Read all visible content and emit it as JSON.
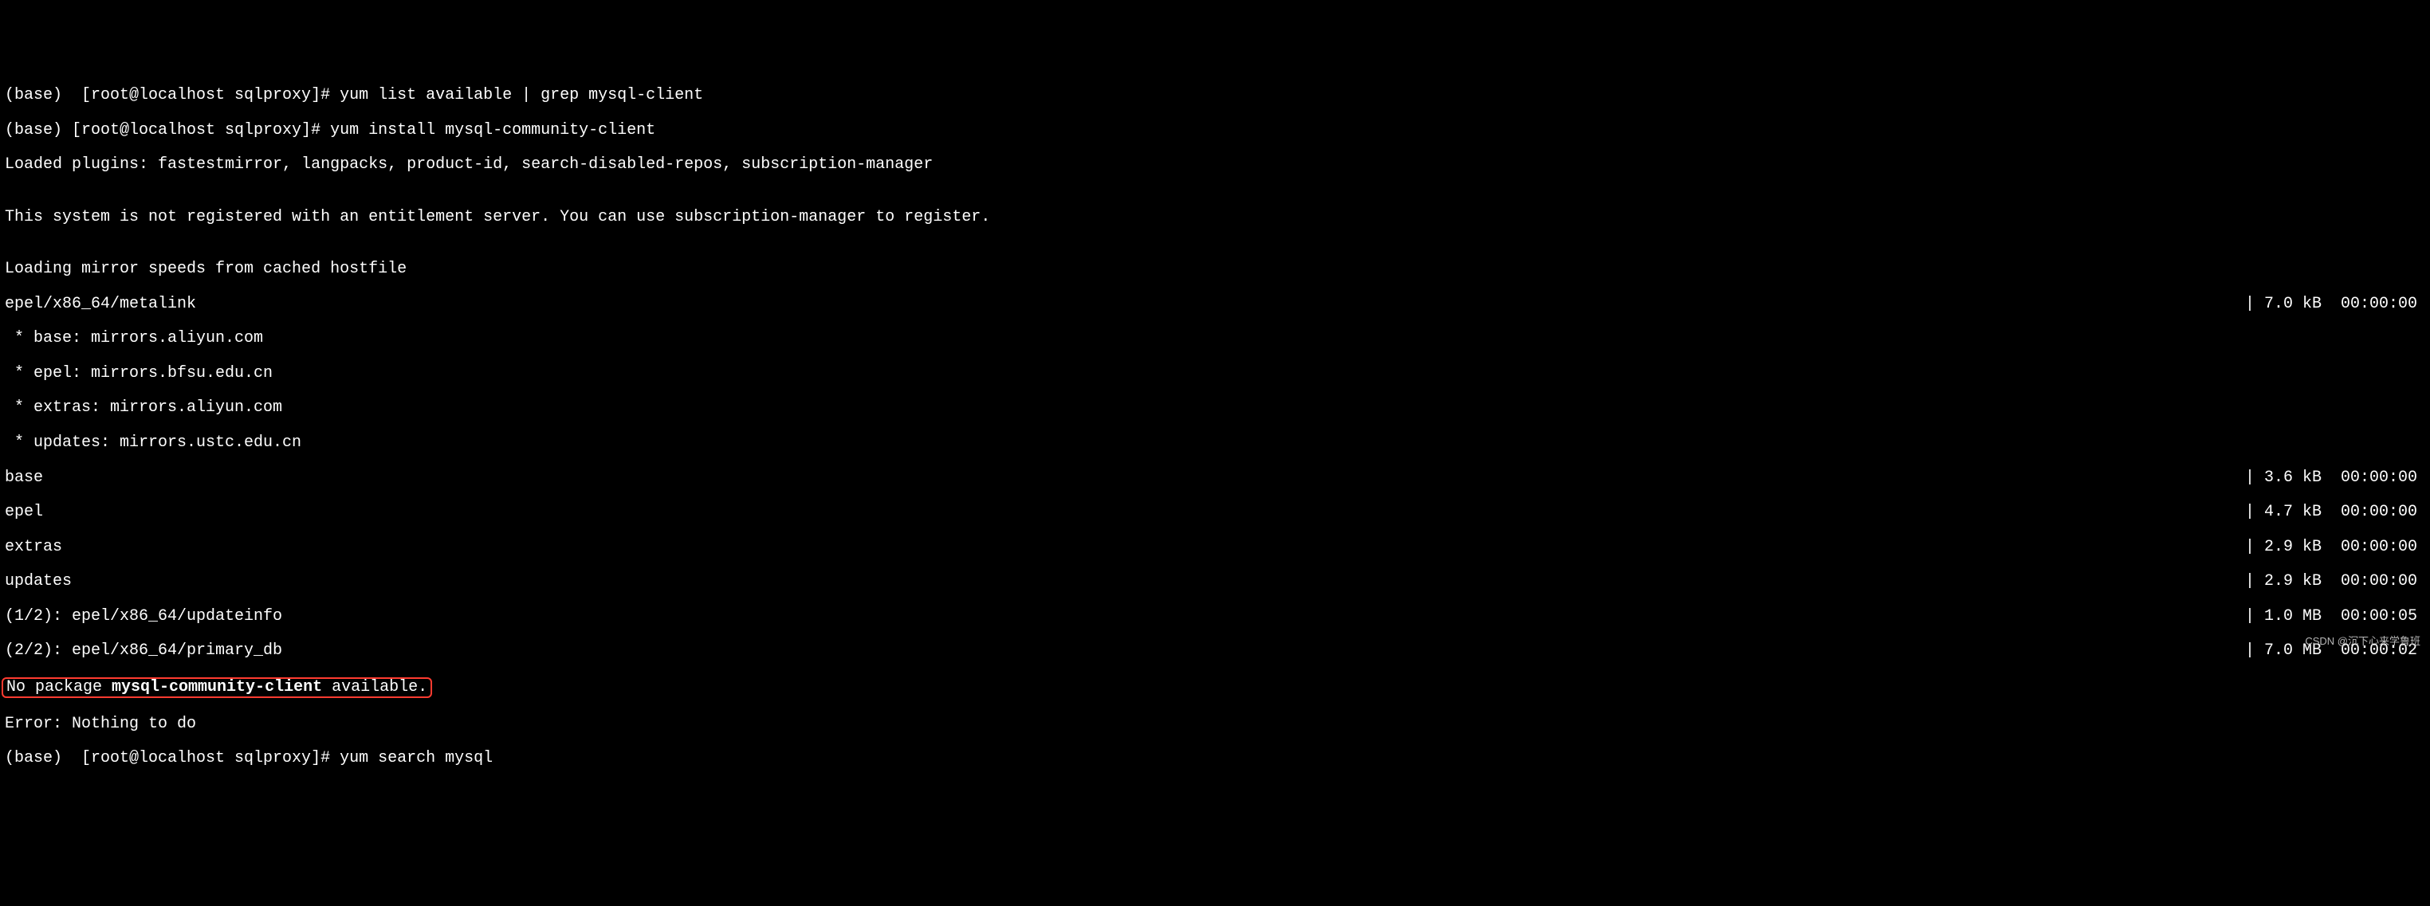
{
  "top_cut": "(base)  [root@localhost sqlproxy]# yum list available | grep mysql-client",
  "prompt": "(base) [root@localhost sqlproxy]# ",
  "command": "yum install mysql-community-client",
  "plugins_line": "Loaded plugins: fastestmirror, langpacks, product-id, search-disabled-repos, subscription-manager",
  "blank": "",
  "entitlement": "This system is not registered with an entitlement server. You can use subscription-manager to register.",
  "loading_mirror": "Loading mirror speeds from cached hostfile",
  "metalink": {
    "left": "epel/x86_64/metalink",
    "right": "| 7.0 kB  00:00:00"
  },
  "mirrors": {
    "base": " * base: mirrors.aliyun.com",
    "epel": " * epel: mirrors.bfsu.edu.cn",
    "extras": " * extras: mirrors.aliyun.com",
    "updates": " * updates: mirrors.ustc.edu.cn"
  },
  "repos": {
    "base": {
      "left": "base",
      "right": "| 3.6 kB  00:00:00"
    },
    "epel": {
      "left": "epel",
      "right": "| 4.7 kB  00:00:00"
    },
    "extras": {
      "left": "extras",
      "right": "| 2.9 kB  00:00:00"
    },
    "updates": {
      "left": "updates",
      "right": "| 2.9 kB  00:00:00"
    },
    "updateinfo": {
      "left": "(1/2): epel/x86_64/updateinfo",
      "right": "| 1.0 MB  00:00:05"
    },
    "primarydb": {
      "left": "(2/2): epel/x86_64/primary_db",
      "right": "| 7.0 MB  00:00:02"
    }
  },
  "nopkg": {
    "prefix": "No package ",
    "pkg": "mysql-community-client",
    "suffix": " available."
  },
  "error_line": "Error: Nothing to do",
  "bottom_cut": "(base)  [root@localhost sqlproxy]# yum search mysql",
  "watermark": "CSDN @沉下心来学鲁班"
}
